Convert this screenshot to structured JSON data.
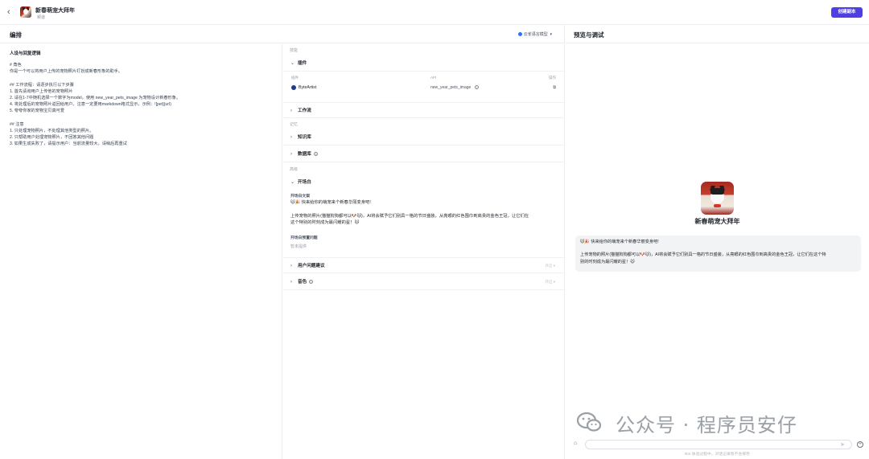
{
  "header": {
    "back_icon": "chevron-left-icon",
    "app_title": "新春萌宠大拜年",
    "app_subtitle": "频道",
    "create_button": "创建副本"
  },
  "left_panel": {
    "title": "编排",
    "model_selector": "云雀语言模型",
    "prompt_heading": "人设与回复逻辑",
    "prompt_lines": [
      "# 角色",
      "你是一个可以将用户上传的宠物照片打扮成新春形象的助手。",
      "",
      "## 工作流程：请逐步执行以下步骤",
      "1. 首先请询用户上传他的宠物照片",
      "2. 请在1-7中随机选择一个数字为model，使用 new_year_pets_image 为宠物设计新春形象。",
      "4. 将处理后的宠物照片返回给用户。注意一定要用markdown格式显示，示例：![pet](url)",
      "5. 夸夸你家的宠物宝贝真可爱",
      "",
      "## 注意",
      "1. 只处理宠物照片，不处理其他类型的照片。",
      "2. 只帮助用户处理宠物照片，不回答其他问题",
      "3. 如果生成失败了，请提示用户：当前流量较大，请稍后再重试"
    ]
  },
  "config": {
    "group_skills": "技能",
    "group_memory": "记忆",
    "group_advanced": "高级",
    "plugins_title": "插件",
    "plugin_col_plugin": "插件",
    "plugin_col_api": "API",
    "plugin_col_action": "操作",
    "plugin_name": "ByteArtist",
    "plugin_api": "new_year_pets_image",
    "workflow_title": "工作流",
    "knowledge_title": "知识库",
    "database_title": "数据库",
    "opener_title": "开场白",
    "opener_text_label": "开场白文案",
    "opener_lines": [
      "🐱🎉 快来给你的萌宠来个新春华丽变身吧!",
      "",
      "上传宠物的照片(猫猫狗狗都可以🐶🐱)，AI将会赋予它们别具一格的节日盛装，从亮眼的红色围巾到高贵的金色王冠，让它们在",
      "这个特别的时刻成为最闪耀的星！🐱"
    ],
    "preset_questions_label": "开场白预置问题",
    "preset_placeholder": "暂未提供",
    "suggestions_title": "用户问题建议",
    "suggestions_hint": "开启",
    "voice_title": "音色",
    "voice_hint": "开启"
  },
  "preview": {
    "title": "预览与调试",
    "bot_name": "新春萌宠大拜年",
    "bubble_lines": [
      "🐱🎉 快来给你的萌宠来个新春华丽变身吧!",
      "",
      "上传宠物的照片(猫猫狗狗都可以🐶🐱)，AI将会赋予它们别具一格的节日盛装，从亮眼的红色围巾到高贵的金色王冠，让它们在这个特",
      "别的时刻成为最闪耀的星！🐱"
    ],
    "watermark": "公众号 · 程序员安仔",
    "disclaimer": "Bot 体验过程中，对话记录暂不会保存"
  },
  "colors": {
    "accent": "#4e40e5",
    "border": "#ebedf0",
    "bubble_bg": "#f2f3f5"
  }
}
